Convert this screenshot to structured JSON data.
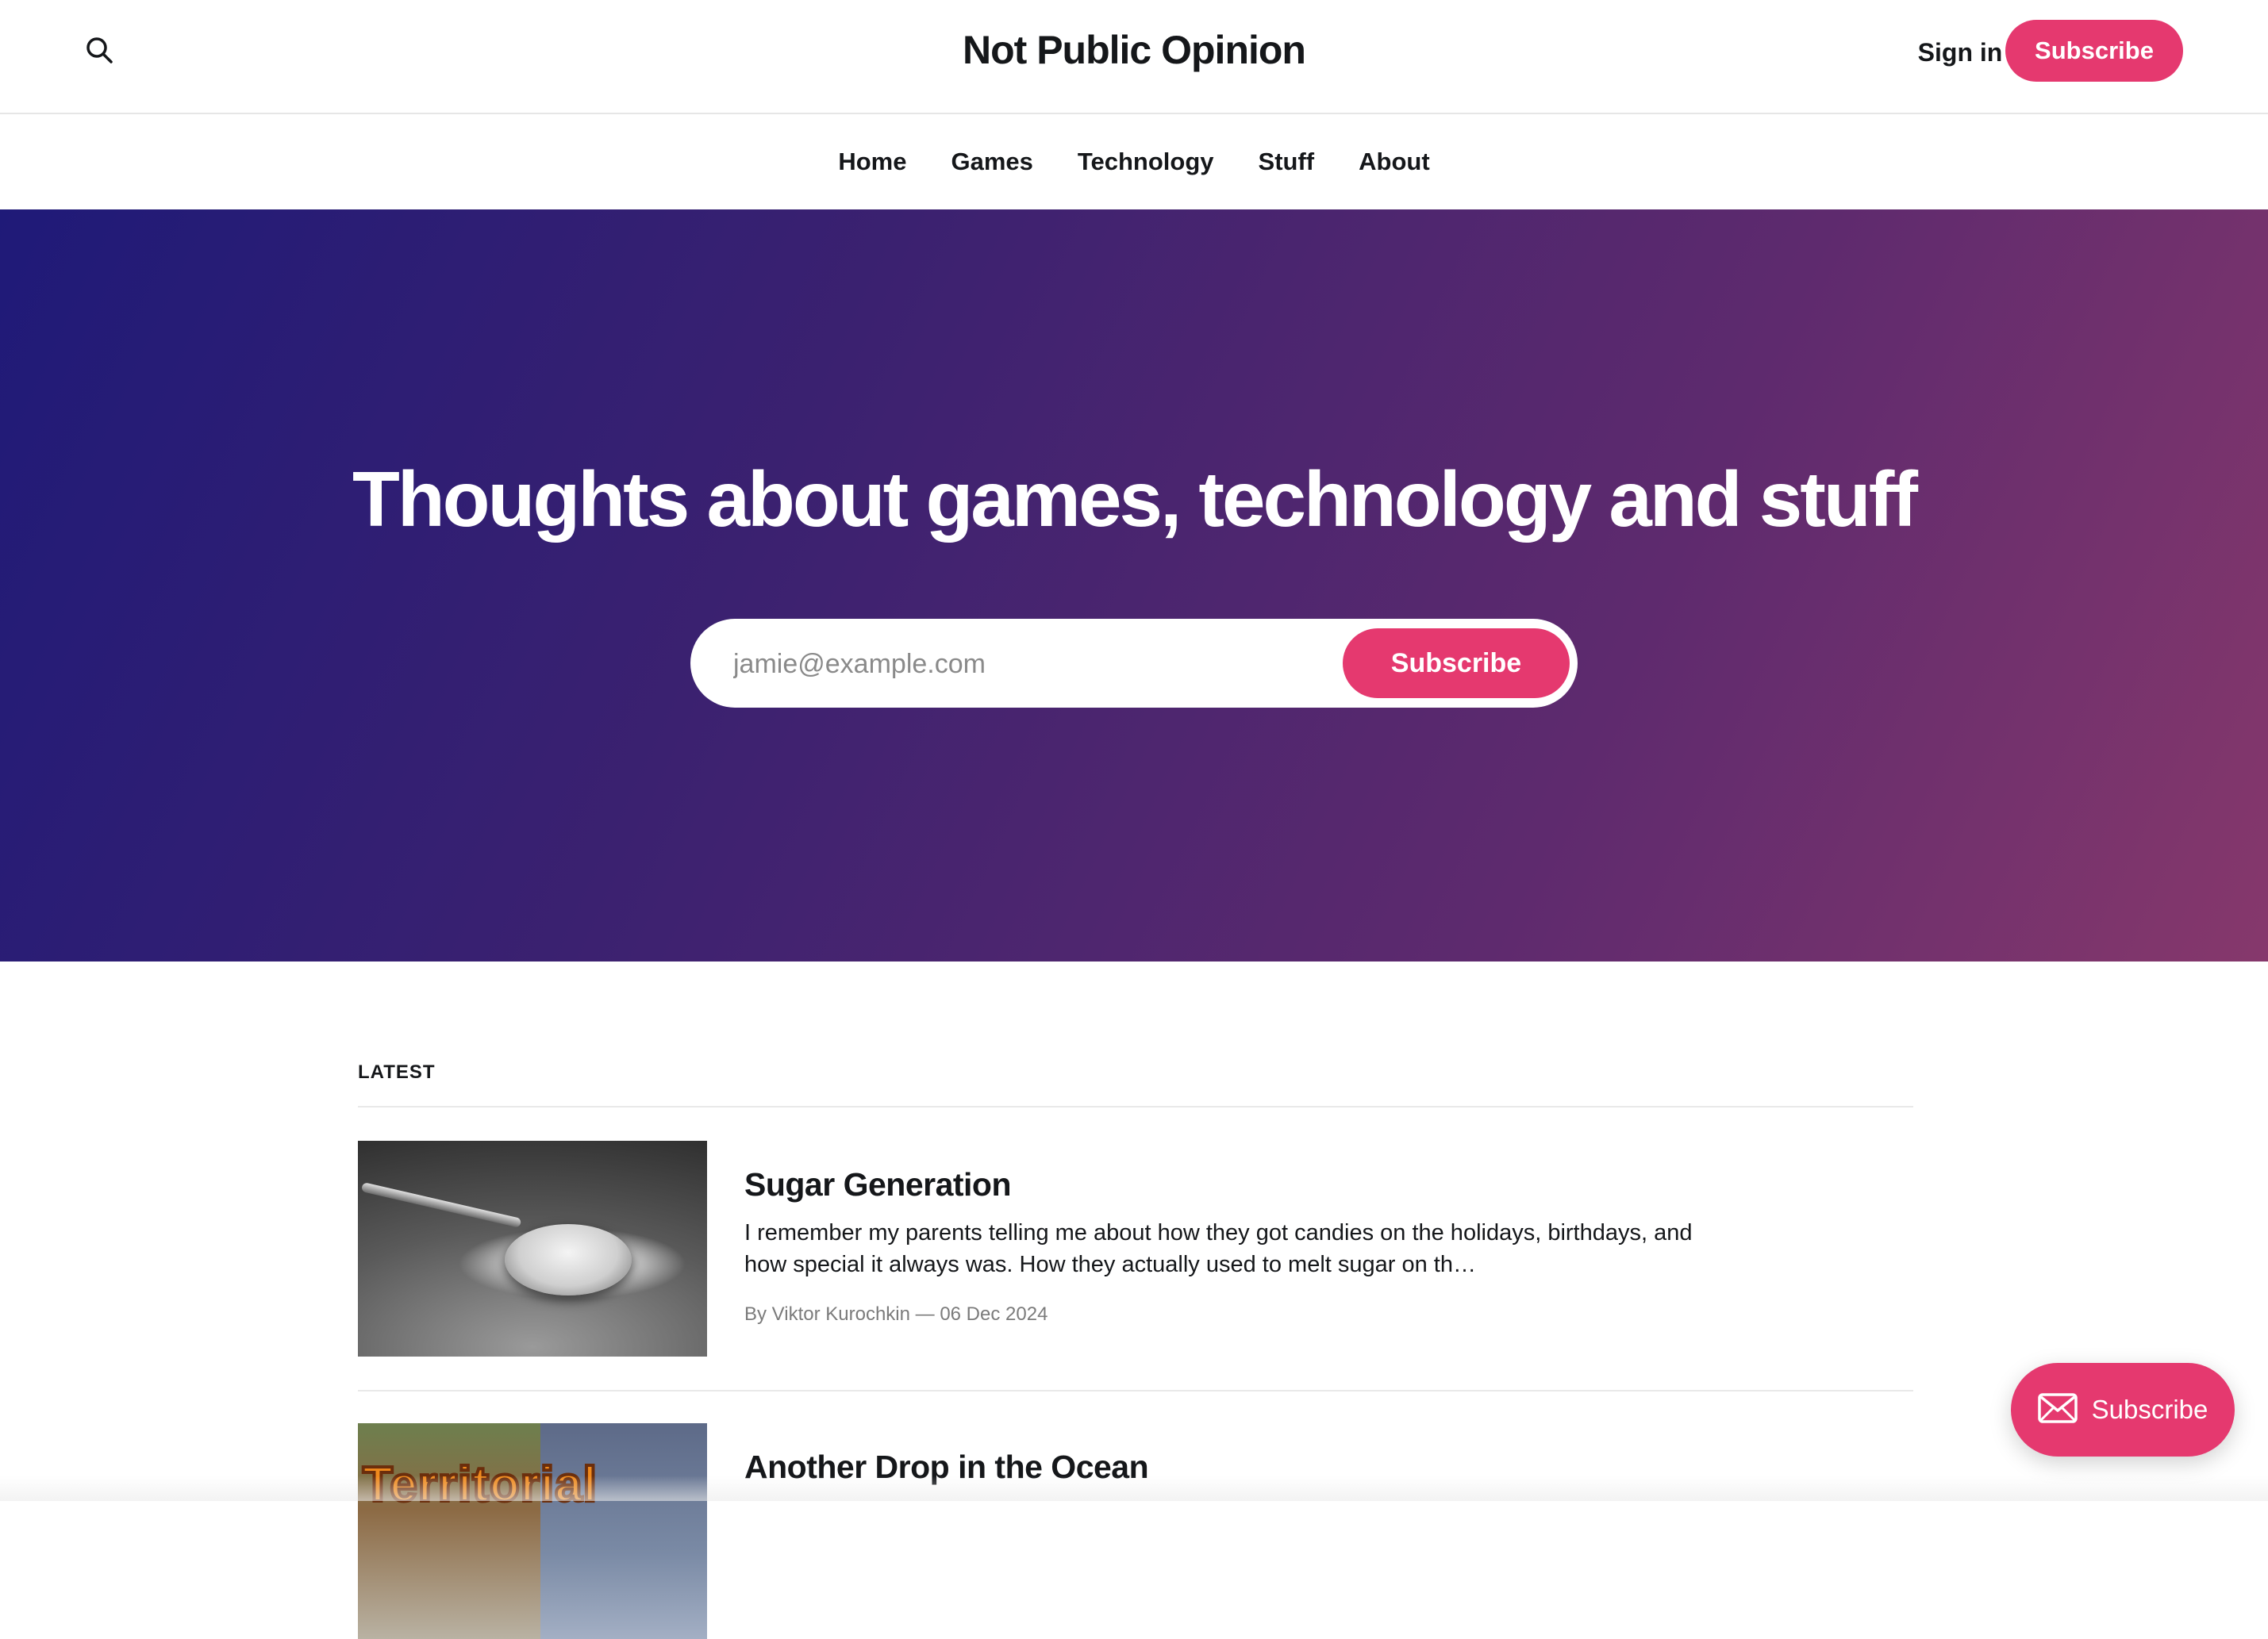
{
  "theme": {
    "accent": "#e5396f"
  },
  "header": {
    "title": "Not Public Opinion",
    "sign_in": "Sign in",
    "subscribe": "Subscribe",
    "search_icon": "search-icon"
  },
  "nav": {
    "items": [
      {
        "label": "Home"
      },
      {
        "label": "Games"
      },
      {
        "label": "Technology"
      },
      {
        "label": "Stuff"
      },
      {
        "label": "About"
      }
    ]
  },
  "hero": {
    "title": "Thoughts about games, technology and stuff",
    "email_placeholder": "jamie@example.com",
    "subscribe": "Subscribe"
  },
  "latest": {
    "label": "LATEST",
    "posts": [
      {
        "title": "Sugar Generation",
        "excerpt": "I remember my parents telling me about how they got candies on the holidays, birthdays, and how special it always was. How they actually used to melt sugar on th…",
        "meta": "By Viktor Kurochkin — 06 Dec 2024"
      },
      {
        "title": "Another Drop in the Ocean",
        "thumb_text": "Territorial"
      }
    ]
  },
  "portal": {
    "label": "Subscribe",
    "icon": "envelope-icon"
  }
}
